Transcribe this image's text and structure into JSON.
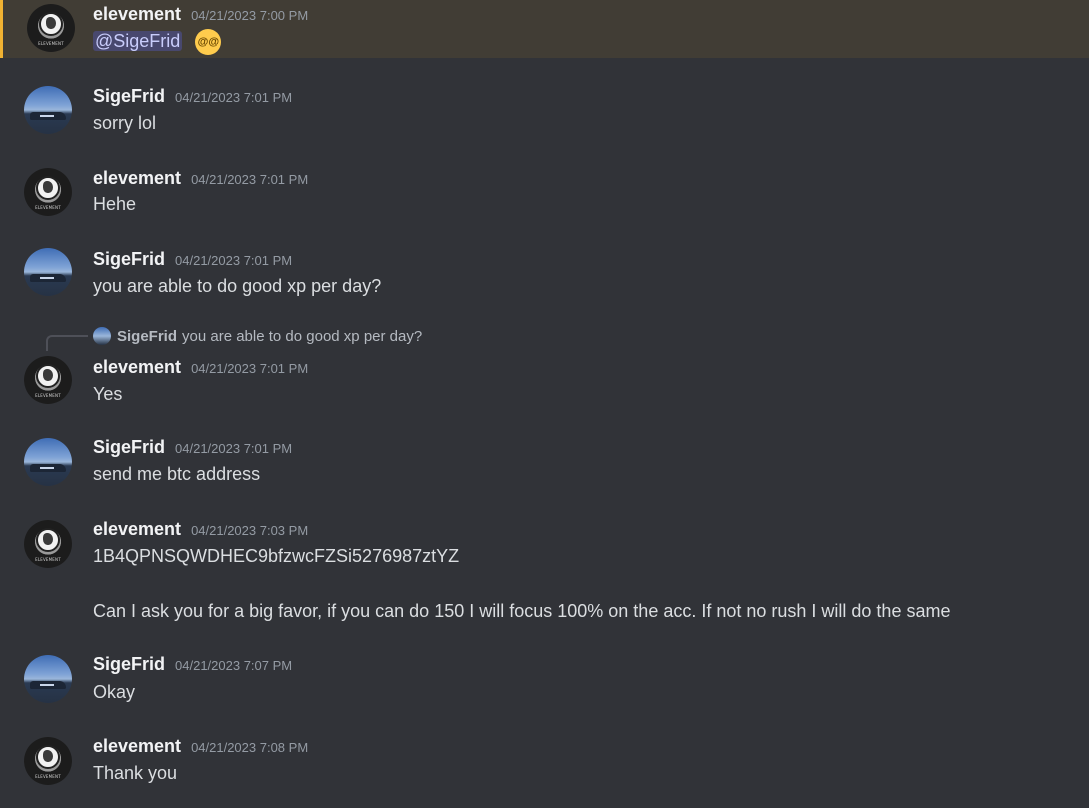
{
  "messages": [
    {
      "author": "elevement",
      "avatar": "elevement",
      "timestamp": "04/21/2023 7:00 PM",
      "mention": "@SigeFrid",
      "emoji": "dizzy-face-emoji"
    },
    {
      "author": "SigeFrid",
      "avatar": "sigefrid",
      "timestamp": "04/21/2023 7:01 PM",
      "text": "sorry lol"
    },
    {
      "author": "elevement",
      "avatar": "elevement",
      "timestamp": "04/21/2023 7:01 PM",
      "text": "Hehe"
    },
    {
      "author": "SigeFrid",
      "avatar": "sigefrid",
      "timestamp": "04/21/2023 7:01 PM",
      "text": "you are able to do good xp per day?"
    },
    {
      "author": "elevement",
      "avatar": "elevement",
      "timestamp": "04/21/2023 7:01 PM",
      "text": "Yes",
      "reply": {
        "author": "SigeFrid",
        "text": "you are able to do good xp per day?"
      }
    },
    {
      "author": "SigeFrid",
      "avatar": "sigefrid",
      "timestamp": "04/21/2023 7:01 PM",
      "text": "send me btc address"
    },
    {
      "author": "elevement",
      "avatar": "elevement",
      "timestamp": "04/21/2023 7:03 PM",
      "text": "1B4QPNSQWDHEC9bfzwcFZSi5276987ztYZ",
      "text2": "Can I ask you for a big favor, if you can do 150 I will focus 100% on the acc. If not no rush I will do the same"
    },
    {
      "author": "SigeFrid",
      "avatar": "sigefrid",
      "timestamp": "04/21/2023 7:07 PM",
      "text": "Okay"
    },
    {
      "author": "elevement",
      "avatar": "elevement",
      "timestamp": "04/21/2023 7:08 PM",
      "text": "Thank you"
    }
  ],
  "avatar_caption": "ELEVEMENT",
  "colors": {
    "background": "#313338",
    "mention_highlight": "#413d35",
    "mention_bar": "#f0b232",
    "name": "#f2f3f5",
    "timestamp": "#949ba4"
  }
}
